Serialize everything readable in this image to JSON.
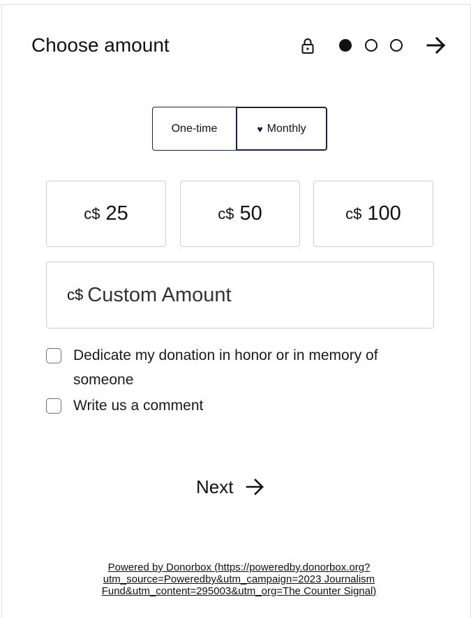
{
  "header": {
    "title": "Choose amount",
    "current_step": 1,
    "total_steps": 3
  },
  "frequency": {
    "one_time_label": "One-time",
    "monthly_label": "Monthly",
    "selected": "Monthly"
  },
  "amounts": {
    "currency": "c$",
    "options": [
      "25",
      "50",
      "100"
    ]
  },
  "custom_amount": {
    "currency": "c$",
    "placeholder": "Custom Amount"
  },
  "options": {
    "dedicate_label": "Dedicate my donation in honor or in memory of someone",
    "comment_label": "Write us a comment"
  },
  "next_label": "Next",
  "footer_link": "Powered by Donorbox (https://poweredby.donorbox.org?utm_source=Poweredby&utm_campaign=2023 Journalism Fund&utm_content=295003&utm_org=The Counter Signal)",
  "colors": {
    "accent": "#1c1f4b",
    "border": "#cfcfcf",
    "text": "#111111"
  },
  "icons": {
    "lock": "lock-icon",
    "step_active": "filled-circle",
    "step_inactive": "hollow-circle",
    "next_arrow": "arrow-right-icon",
    "heart": "heart-icon"
  }
}
